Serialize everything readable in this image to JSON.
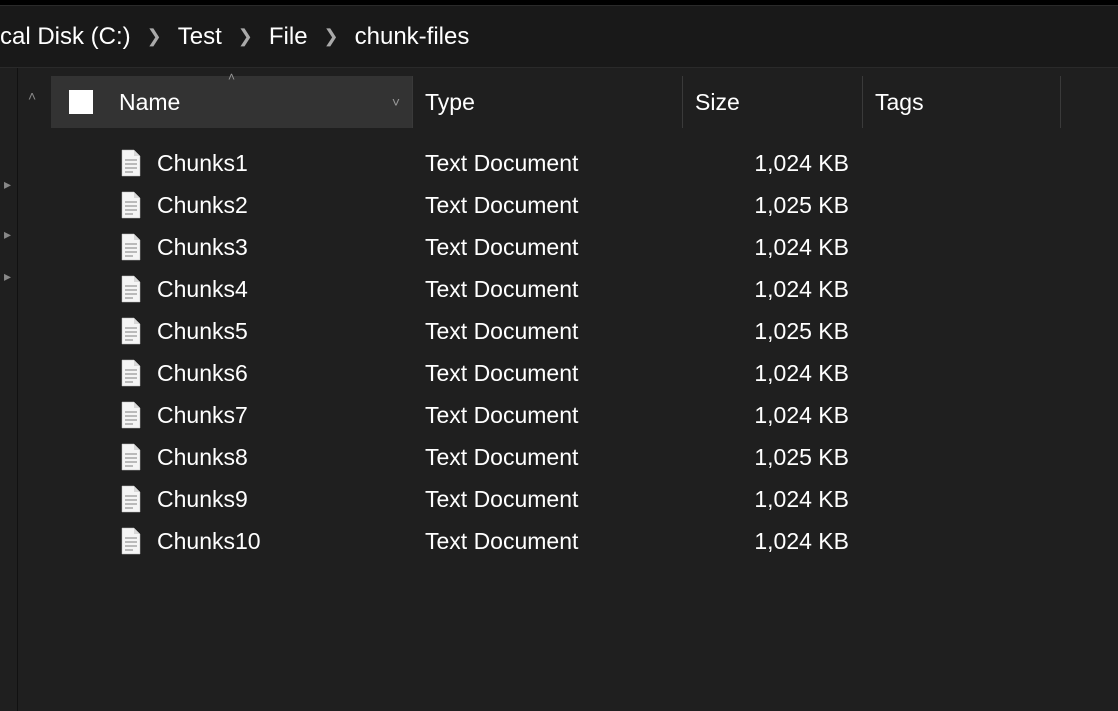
{
  "breadcrumb": [
    {
      "label": "cal Disk (C:)"
    },
    {
      "label": "Test"
    },
    {
      "label": "File"
    },
    {
      "label": "chunk-files"
    }
  ],
  "columns": {
    "name": "Name",
    "type": "Type",
    "size": "Size",
    "tags": "Tags"
  },
  "files": [
    {
      "name": "Chunks1",
      "type": "Text Document",
      "size": "1,024 KB",
      "tags": ""
    },
    {
      "name": "Chunks2",
      "type": "Text Document",
      "size": "1,025 KB",
      "tags": ""
    },
    {
      "name": "Chunks3",
      "type": "Text Document",
      "size": "1,024 KB",
      "tags": ""
    },
    {
      "name": "Chunks4",
      "type": "Text Document",
      "size": "1,024 KB",
      "tags": ""
    },
    {
      "name": "Chunks5",
      "type": "Text Document",
      "size": "1,025 KB",
      "tags": ""
    },
    {
      "name": "Chunks6",
      "type": "Text Document",
      "size": "1,024 KB",
      "tags": ""
    },
    {
      "name": "Chunks7",
      "type": "Text Document",
      "size": "1,024 KB",
      "tags": ""
    },
    {
      "name": "Chunks8",
      "type": "Text Document",
      "size": "1,025 KB",
      "tags": ""
    },
    {
      "name": "Chunks9",
      "type": "Text Document",
      "size": "1,024 KB",
      "tags": ""
    },
    {
      "name": "Chunks10",
      "type": "Text Document",
      "size": "1,024 KB",
      "tags": ""
    }
  ]
}
